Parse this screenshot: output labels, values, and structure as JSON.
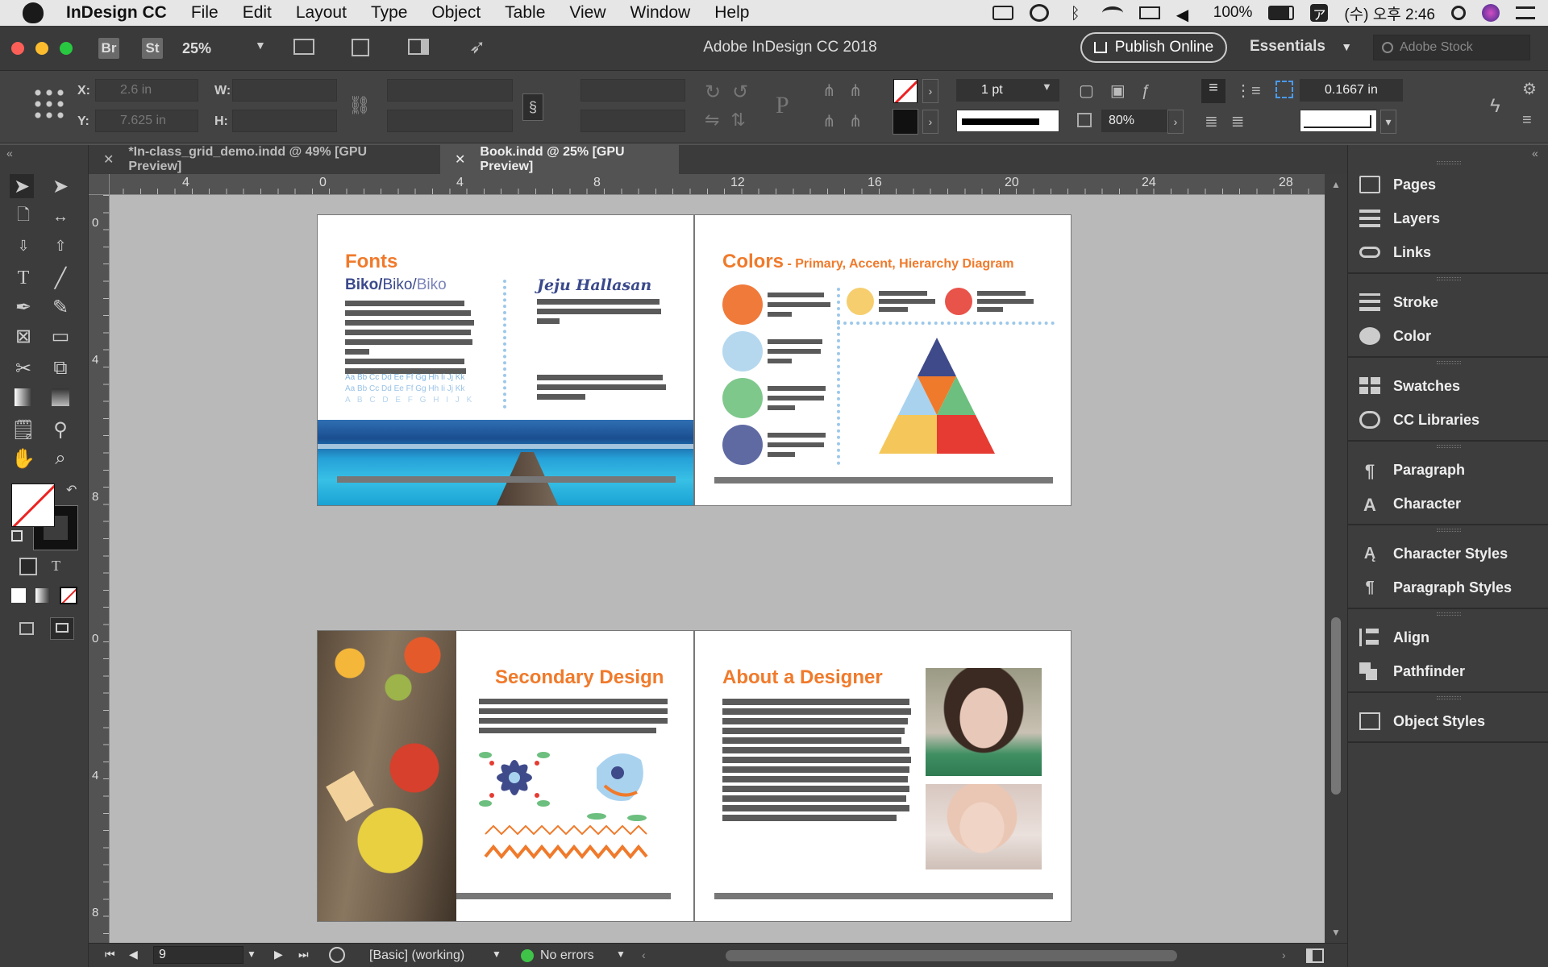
{
  "menubar": {
    "app_name": "InDesign CC",
    "items": [
      "File",
      "Edit",
      "Layout",
      "Type",
      "Object",
      "Table",
      "View",
      "Window",
      "Help"
    ],
    "battery": "100%",
    "clock": "(수) 오후 2:46"
  },
  "titlebar": {
    "title": "Adobe InDesign CC 2018",
    "br_label": "Br",
    "st_label": "St",
    "zoom": "25%",
    "publish_label": "Publish Online",
    "workspace": "Essentials",
    "stock_placeholder": "Adobe Stock"
  },
  "control": {
    "x_label": "X:",
    "x_value": "2.6 in",
    "y_label": "Y:",
    "y_value": "7.625 in",
    "w_label": "W:",
    "h_label": "H:",
    "stroke_weight": "1 pt",
    "opacity": "80%",
    "gap_value": "0.1667 in"
  },
  "tabs": [
    {
      "label": "*In-class_grid_demo.indd @ 49% [GPU Preview]"
    },
    {
      "label": "Book.indd @ 25% [GPU Preview]"
    }
  ],
  "ruler": {
    "h_ticks": [
      "4",
      "0",
      "4",
      "8",
      "12",
      "16",
      "20",
      "24",
      "28"
    ],
    "v_ticks": [
      "0",
      "4",
      "8",
      "0",
      "4",
      "8"
    ]
  },
  "spread1": {
    "fonts_title": "Fonts",
    "biko_a": "Biko/",
    "biko_b": "Biko/",
    "biko_c": "Biko",
    "jeju": "Jeju Hallasan",
    "alpha1": "Aa Bb Cc Dd Ee Ff Gg Hh Ii Jj Kk",
    "alpha2": "Aa Bb Cc Dd Ee Ff Gg Hh Ii Jj Kk",
    "alpha3": "A B C D E F G H I J K",
    "colors_title": "Colors",
    "colors_sub": " - Primary, Accent, Hierarchy Diagram",
    "swatch_colors": [
      "#f07a3a",
      "#b5d8ef",
      "#7ec88c",
      "#5f6aa3"
    ],
    "accent_colors": [
      "#f6ce6e",
      "#e8534a"
    ],
    "pyramid_colors": [
      "#3e4a8a",
      "#f07a2b",
      "#a9d2ef",
      "#6cbf7e",
      "#f5c75a",
      "#e63b32"
    ]
  },
  "spread2": {
    "secondary_title": "Secondary Design",
    "designer_title": "About a Designer"
  },
  "panels": [
    {
      "label": "Pages"
    },
    {
      "label": "Layers"
    },
    {
      "label": "Links"
    },
    {
      "label": "Stroke"
    },
    {
      "label": "Color"
    },
    {
      "label": "Swatches"
    },
    {
      "label": "CC Libraries"
    },
    {
      "label": "Paragraph"
    },
    {
      "label": "Character"
    },
    {
      "label": "Character Styles"
    },
    {
      "label": "Paragraph Styles"
    },
    {
      "label": "Align"
    },
    {
      "label": "Pathfinder"
    },
    {
      "label": "Object Styles"
    }
  ],
  "status": {
    "page_number": "9",
    "style": "[Basic] (working)",
    "preflight": "No errors"
  }
}
